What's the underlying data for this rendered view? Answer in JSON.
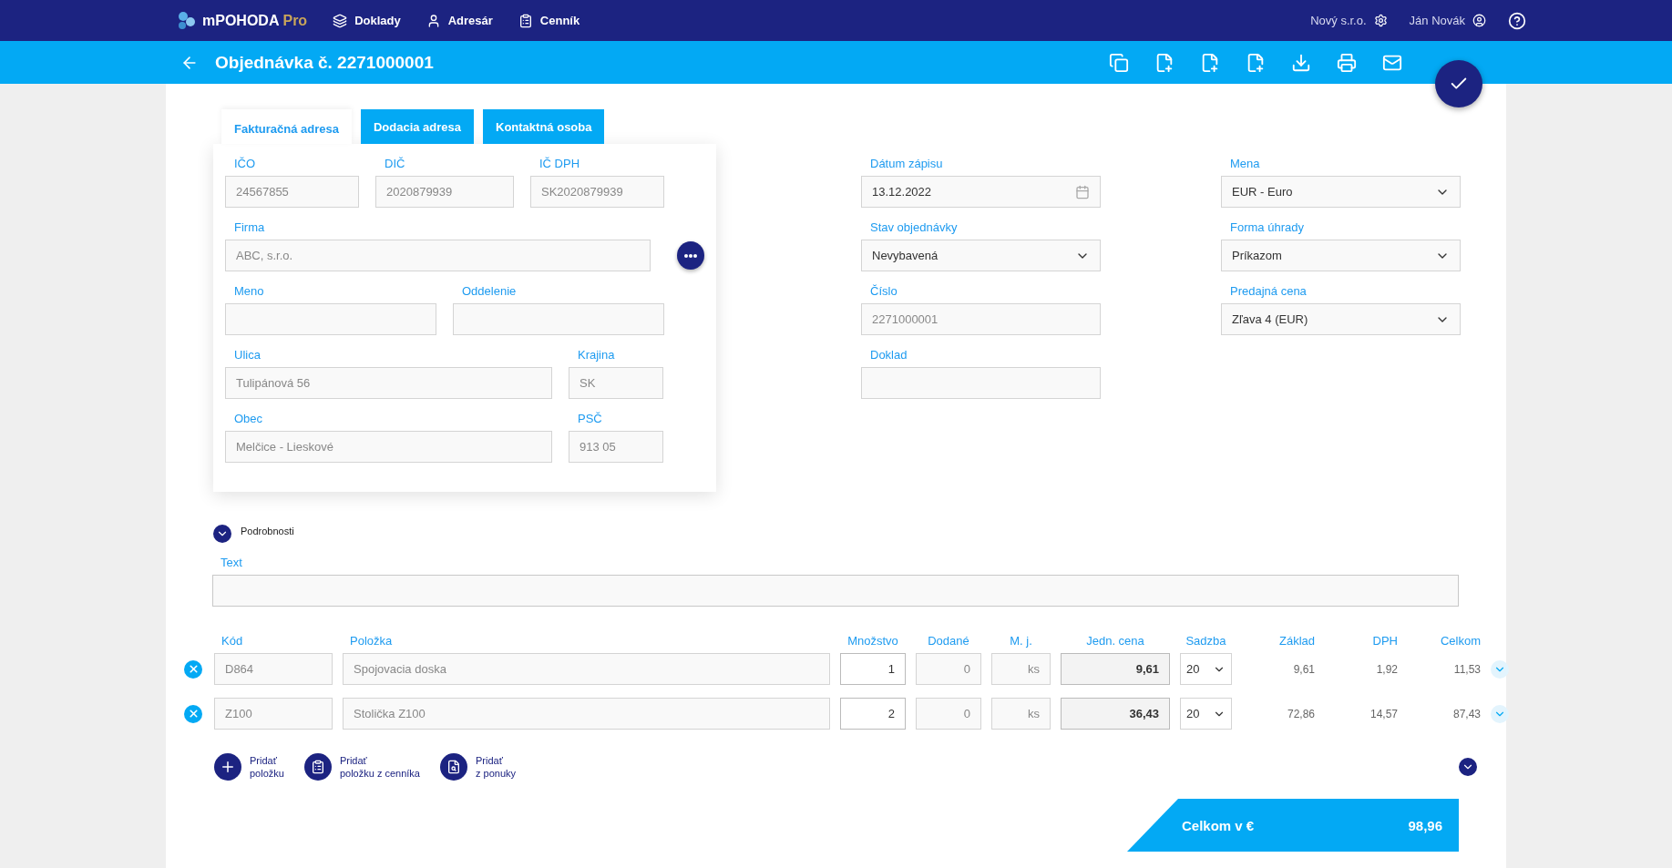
{
  "topbar": {
    "logo_text": "mPOHODA",
    "logo_suffix": "Pro",
    "nav": [
      {
        "label": "Doklady",
        "kind": "documents"
      },
      {
        "label": "Adresár",
        "kind": "person"
      },
      {
        "label": "Cenník",
        "kind": "clipboard"
      }
    ],
    "company": "Nový s.r.o.",
    "user": "Ján Novák"
  },
  "header": {
    "title": "Objednávka č. 2271000001"
  },
  "tabs": [
    {
      "label": "Fakturačná adresa",
      "selected": true
    },
    {
      "label": "Dodacia adresa",
      "selected": false
    },
    {
      "label": "Kontaktná osoba",
      "selected": false
    }
  ],
  "address_rows": [
    [
      {
        "label": "IČO",
        "value": "24567855"
      },
      {
        "label": "DIČ",
        "value": "2020879939"
      },
      {
        "label": "IČ DPH",
        "value": "SK2020879939"
      }
    ],
    [
      {
        "label": "Firma",
        "value": "ABC, s.r.o."
      }
    ],
    [
      {
        "label": "Meno"
      },
      {
        "label": "Oddelenie"
      }
    ],
    [
      {
        "label": "Ulica",
        "value": "Tulipánová 56"
      },
      {
        "label": "Krajina",
        "value": "SK"
      }
    ],
    [
      {
        "label": "Obec",
        "value": "Melčice - Lieskové"
      },
      {
        "label": "PSČ",
        "value": "913 05"
      }
    ]
  ],
  "document_fields": [
    [
      {
        "label": "Dátum zápisu",
        "value": "13.12.2022",
        "kind": "date"
      },
      {
        "label": "Stav objednávky",
        "value": "Nevybavená",
        "kind": "select"
      },
      {
        "label": "Číslo",
        "value": "2271000001",
        "kind": "readonly"
      },
      {
        "label": "Doklad",
        "kind": "input"
      }
    ],
    [
      {
        "label": "Mena",
        "value": "EUR - Euro",
        "kind": "select"
      },
      {
        "label": "Forma úhrady",
        "value": "Príkazom",
        "kind": "select"
      },
      {
        "label": "Predajná cena",
        "value": "Zľava 4 (EUR)",
        "kind": "select"
      }
    ]
  ],
  "details": {
    "label": "Podrobnosti",
    "expanded": true
  },
  "text_field": {
    "label": "Text"
  },
  "items": {
    "columns": [
      "Kód",
      "Položka",
      "Množstvo",
      "Dodané",
      "M. j.",
      "Jedn. cena",
      "Sadzba",
      "Základ",
      "DPH",
      "Celkom"
    ],
    "rows": [
      {
        "code": "D864",
        "name": "Spojovacia doska",
        "qty": "1",
        "delivered": "0",
        "unit": "ks",
        "unit_price": "9,61",
        "rate": "20",
        "base": "9,61",
        "vat": "1,92",
        "total": "11,53"
      },
      {
        "code": "Z100",
        "name": "Stolička Z100",
        "qty": "2",
        "delivered": "0",
        "unit": "ks",
        "unit_price": "36,43",
        "rate": "20",
        "base": "72,86",
        "vat": "14,57",
        "total": "87,43"
      }
    ]
  },
  "actions": [
    {
      "label": "Pridať\npoložku",
      "kind": "plus"
    },
    {
      "label": "Pridať\npoložku z cenníka",
      "kind": "clipboard"
    },
    {
      "label": "Pridať\nz ponuky",
      "kind": "file"
    }
  ],
  "total": {
    "label": "Celkom v €",
    "value": "98,96"
  }
}
